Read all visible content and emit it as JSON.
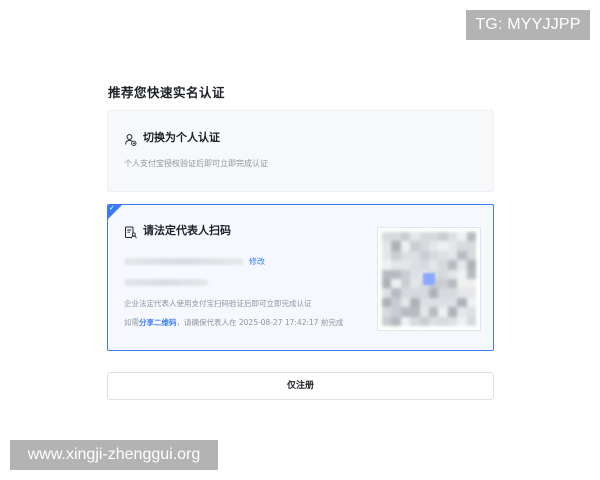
{
  "watermarks": {
    "top": "TG: MYYJJPP",
    "bottom": "www.xingji-zhenggui.org"
  },
  "panel": {
    "title": "推荐您快速实名认证"
  },
  "personal_option": {
    "icon": "person-swap-icon",
    "title": "切换为个人认证",
    "description": "个人支付宝授权验证后即可立即完成认证"
  },
  "legal_option": {
    "icon": "scan-person-icon",
    "title": "请法定代表人扫码",
    "edit_label": "修改",
    "description": "企业法定代表人使用支付宝扫码验证后即可立即完成认证",
    "share_prefix": "如需",
    "share_link": "分享二维码",
    "share_suffix": "，请确保代表人在 2025-08-27 17:42:17 前完成",
    "selected": true
  },
  "register_button": {
    "label": "仅注册"
  },
  "colors": {
    "accent": "#3b7cf5",
    "selected_bg": "#f5f9ff",
    "muted_text": "#8f959e"
  }
}
